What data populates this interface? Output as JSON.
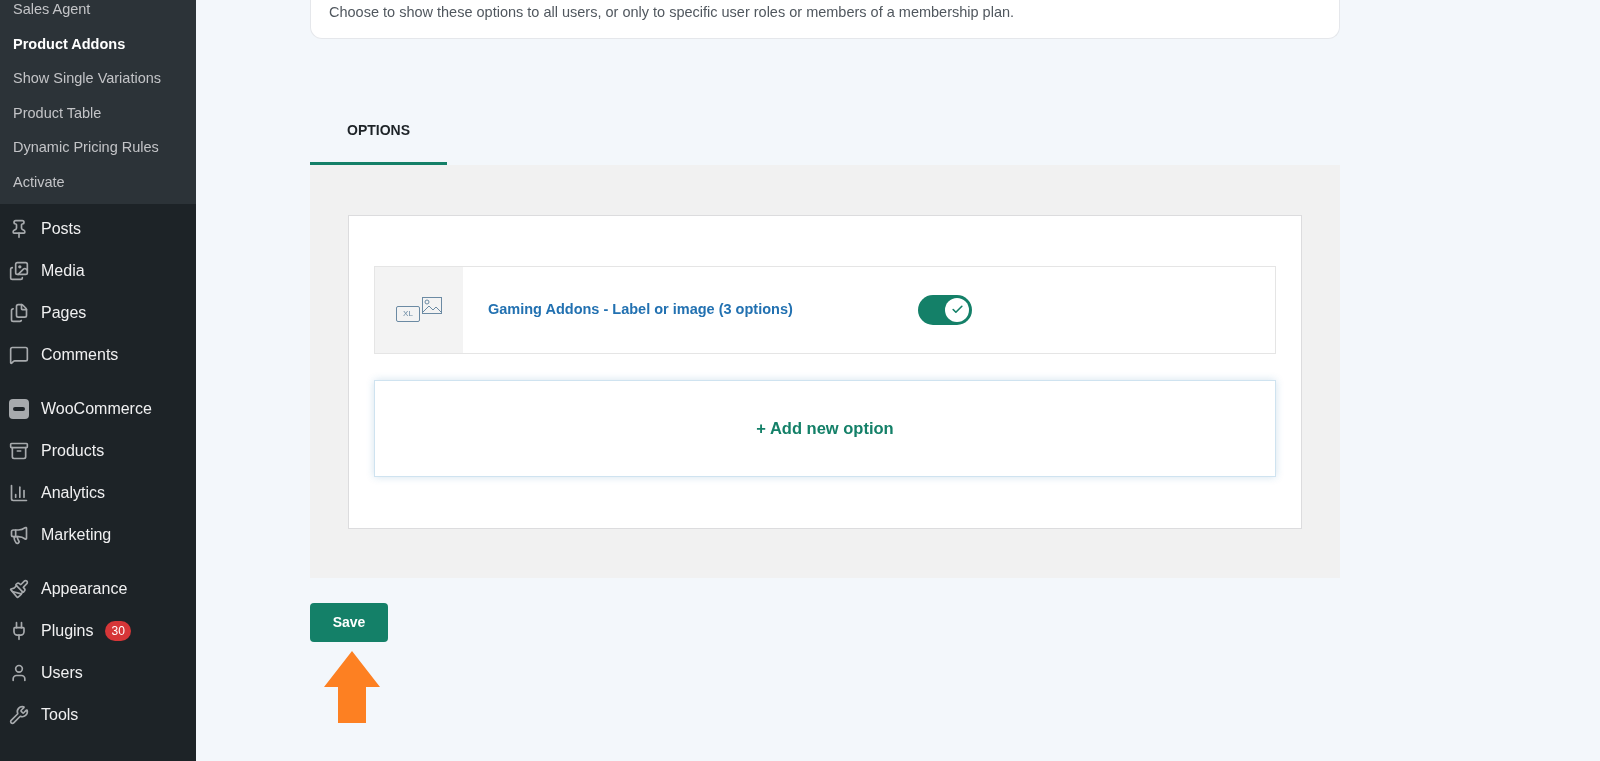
{
  "sidebar": {
    "submenu": [
      {
        "label": "Sales Agent",
        "selected": false
      },
      {
        "label": "Product Addons",
        "selected": true
      },
      {
        "label": "Show Single Variations",
        "selected": false
      },
      {
        "label": "Product Table",
        "selected": false
      },
      {
        "label": "Dynamic Pricing Rules",
        "selected": false
      },
      {
        "label": "Activate",
        "selected": false
      }
    ],
    "groups": [
      [
        {
          "label": "Posts"
        },
        {
          "label": "Media"
        },
        {
          "label": "Pages"
        },
        {
          "label": "Comments"
        }
      ],
      [
        {
          "label": "WooCommerce"
        },
        {
          "label": "Products"
        },
        {
          "label": "Analytics"
        },
        {
          "label": "Marketing"
        }
      ],
      [
        {
          "label": "Appearance"
        },
        {
          "label": "Plugins",
          "badge": "30"
        },
        {
          "label": "Users"
        },
        {
          "label": "Tools"
        }
      ]
    ]
  },
  "visibility_card": {
    "description": "Choose to show these options to all users, or only to specific user roles or members of a membership plan."
  },
  "tabs": [
    {
      "label": "OPTIONS",
      "selected": true
    }
  ],
  "options": [
    {
      "thumbnail_text": "XL",
      "title": "Gaming Addons - Label or image (3 options)",
      "on": true
    }
  ],
  "add_button": "+ Add new option",
  "save_button": "Save"
}
